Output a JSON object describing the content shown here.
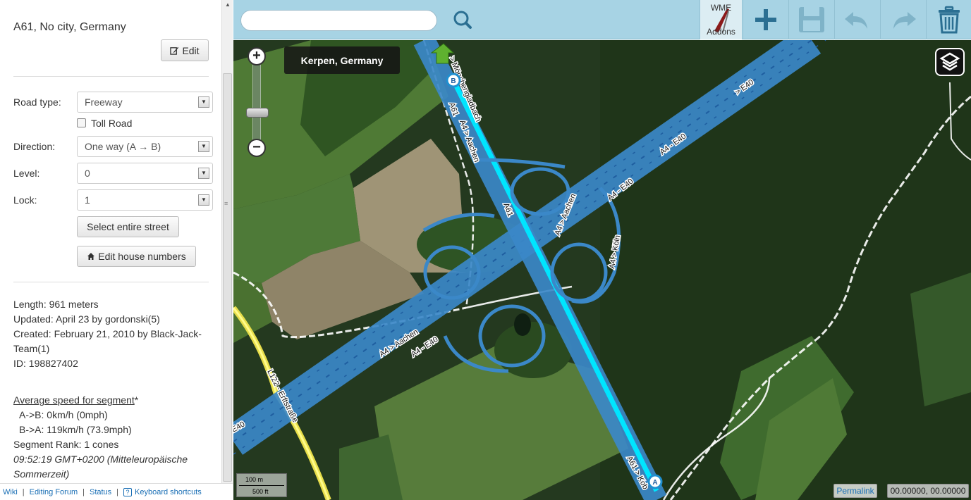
{
  "sidebar": {
    "address": "A61, No city, Germany",
    "edit_label": "Edit",
    "road_type_label": "Road type:",
    "road_type_value": "Freeway",
    "toll_road_label": "Toll Road",
    "direction_label": "Direction:",
    "direction_value": "One way (A → B)",
    "level_label": "Level:",
    "level_value": "0",
    "lock_label": "Lock:",
    "lock_value": "1",
    "select_street_label": "Select entire street",
    "edit_house_numbers_label": "Edit house numbers",
    "length": "Length: 961 meters",
    "updated": "Updated: April 23 by gordonski(5)",
    "created": "Created: February 21, 2010 by Black-Jack-Team(1)",
    "segment_id": "ID: 198827402",
    "avg_speed_title": "Average speed for segment",
    "avg_speed_asterisk": "*",
    "speed_ab": "A->B: 0km/h (0mph)",
    "speed_ba": "B->A: 119km/h (73.9mph)",
    "segment_rank": "Segment Rank: 1 cones",
    "timestamp": "09:52:19 GMT+0200 (Mitteleuropäische Sommerzeit)"
  },
  "footer": {
    "wiki": "Wiki",
    "forum": "Editing Forum",
    "status": "Status",
    "shortcuts_icon": "?",
    "shortcuts": "Keyboard shortcuts"
  },
  "toolbar": {
    "search_placeholder": "",
    "addons_top": "WME",
    "addons_bottom": "Addons"
  },
  "map": {
    "location": "Kerpen, Germany",
    "scale_metric": "100 m",
    "scale_imperial": "500 ft",
    "permalink": "Permalink",
    "coordinates": "00.00000, 00.00000",
    "node_a": "A",
    "node_b": "B",
    "labels": {
      "a61_top": "A61",
      "monchengladbach": "> Mönchengladbach",
      "a4_aachen_top": "A4 > Aachen",
      "a61_center": "A61",
      "a4_aachen_mid": "A4 > Aachen",
      "a4_e40_ne": "A4 - E40",
      "a4_e40_ne2": "A4 - E40",
      "a4_e40_far": "> E40",
      "a4_koln": "A4 > Köln",
      "a4_aachen_sw": "A4 > Aachen",
      "a4_e40_sw": "A4 - E40",
      "l122": "L122 - Erftstraße",
      "e40_left": "E40",
      "a61_koblenz": "A61 > Kob"
    }
  },
  "colors": {
    "toolbar": "#a7d3e4",
    "freeway": "#3b88c8",
    "selected_segment": "#00e5ff",
    "link": "#1a6fb5"
  },
  "icons": [
    "edit-icon",
    "home-icon",
    "search-icon",
    "plus-icon",
    "save-icon",
    "undo-icon",
    "redo-icon",
    "trash-icon",
    "layers-icon",
    "street-view-icon"
  ]
}
